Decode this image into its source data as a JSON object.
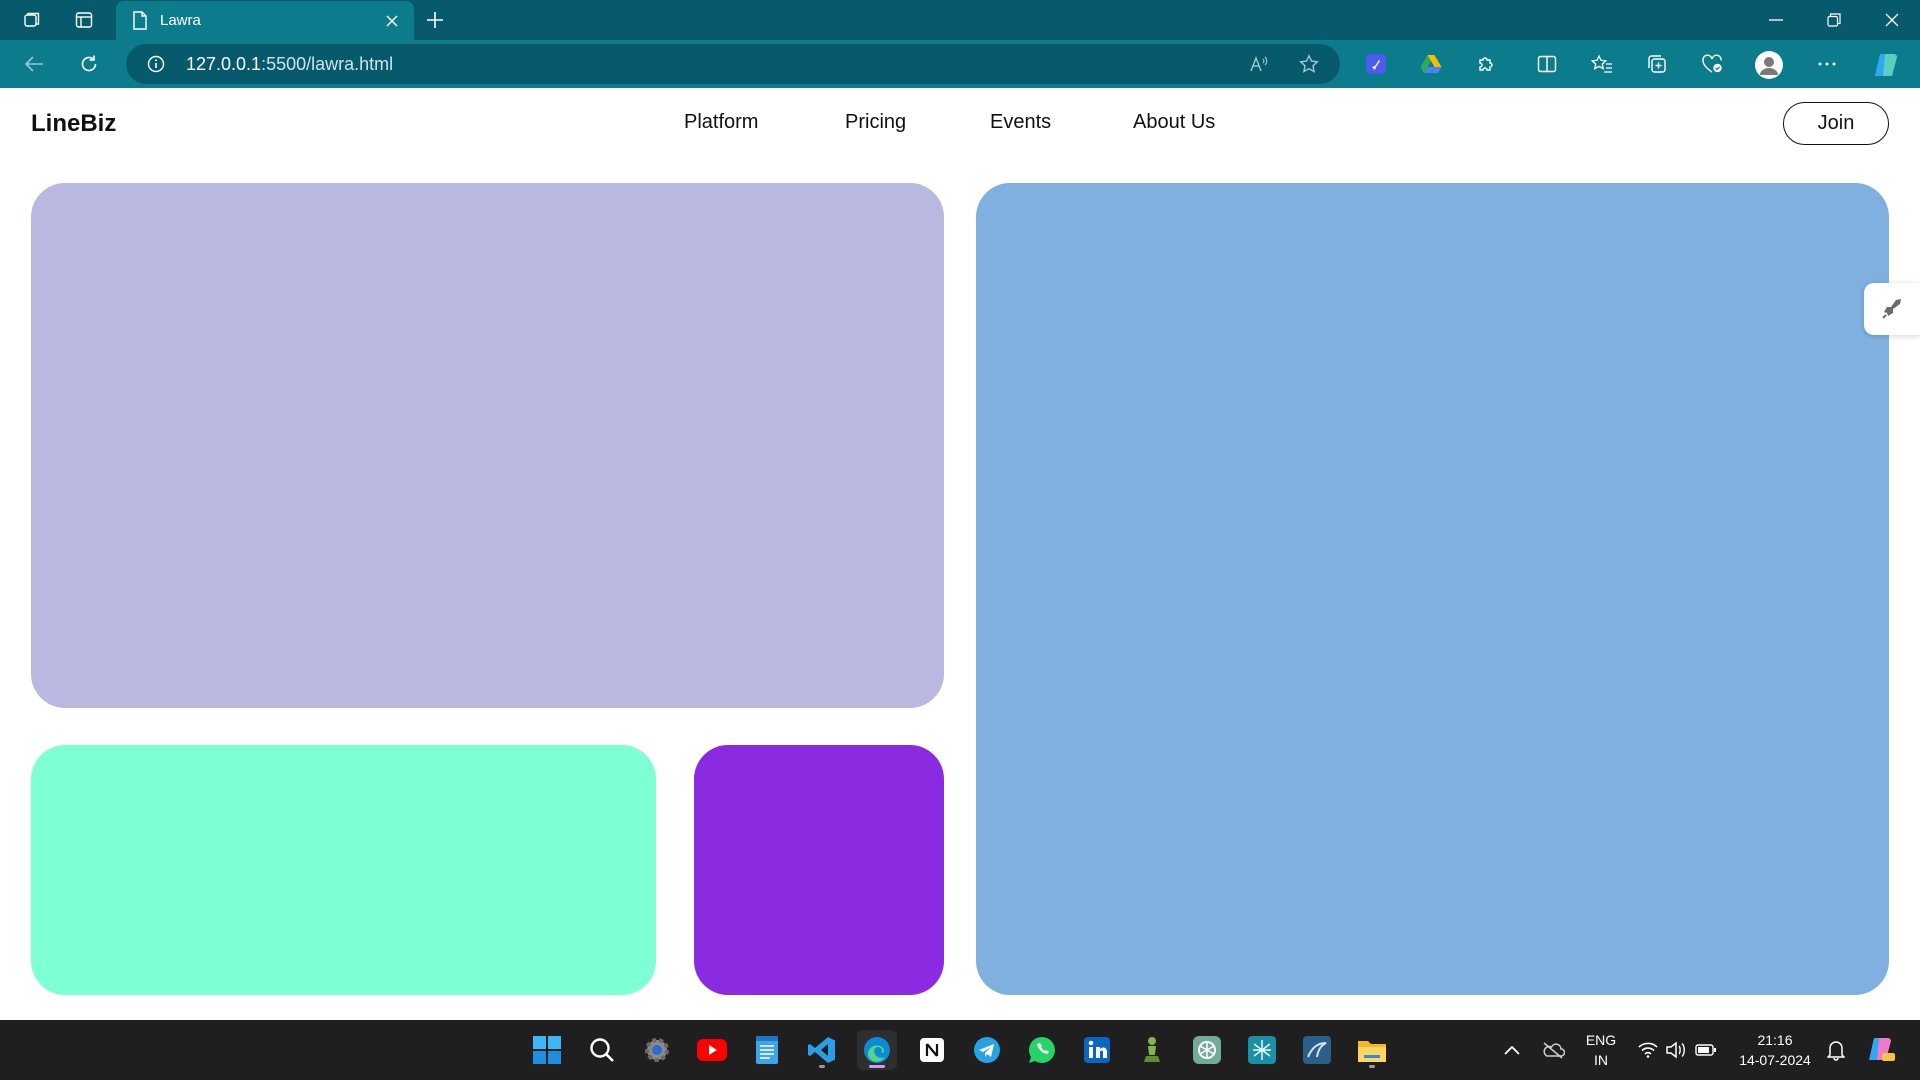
{
  "browser": {
    "tab_title": "Lawra",
    "url_host": "127.0.0.1",
    "url_path": ":5500/lawra.html"
  },
  "page": {
    "logo": "LineBiz",
    "nav": [
      "Platform",
      "Pricing",
      "Events",
      "About Us"
    ],
    "join_label": "Join",
    "cards": {
      "lavender": "#b8b8e0",
      "blue": "#80b0e0",
      "mint": "#7fffd4",
      "purple": "#8a2be2"
    }
  },
  "taskbar": {
    "apps": [
      "windows-start",
      "search",
      "settings",
      "youtube",
      "notepad",
      "vscode",
      "edge",
      "notion",
      "telegram",
      "whatsapp",
      "linkedin",
      "chess",
      "chatgpt",
      "bloom",
      "mysql-workbench",
      "file-explorer"
    ],
    "language": "ENG",
    "region": "IN",
    "time": "21:16",
    "date": "14-07-2024"
  }
}
